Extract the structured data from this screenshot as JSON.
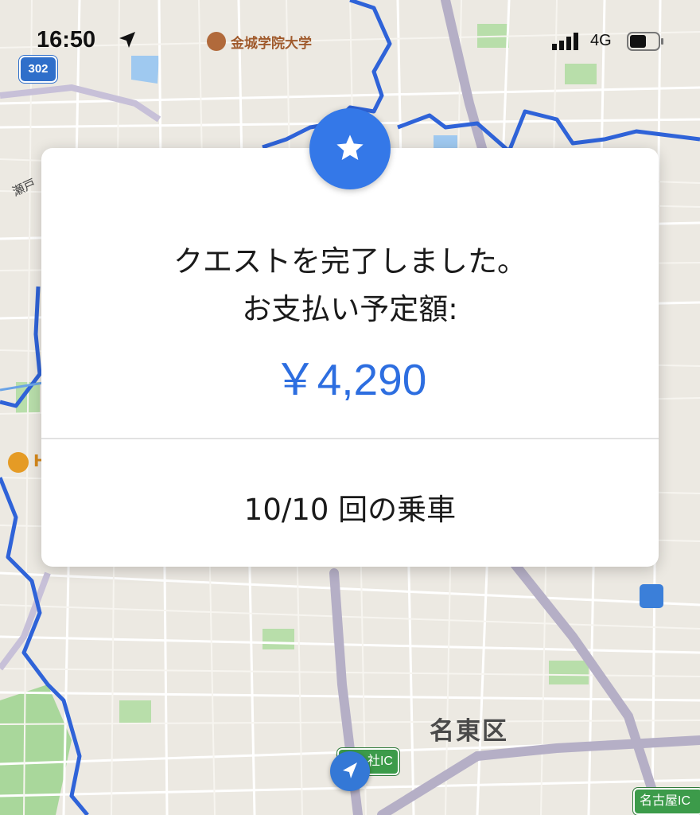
{
  "status_bar": {
    "time": "16:50",
    "network": "4G",
    "icons": [
      "location-arrow-icon",
      "signal-bars-icon",
      "battery-icon"
    ]
  },
  "map": {
    "university_label": "金城学院大学",
    "route_number": "302",
    "area_label_partial": "瀬戸",
    "district_label": "名東区",
    "interchange_1": "社IC",
    "interchange_2": "名古屋IC",
    "shop_label_partial": "H",
    "colors": {
      "road_major": "#b5afc6",
      "boundary": "#2f63d8",
      "park": "#a8d89a"
    }
  },
  "dialog": {
    "message_line1": "クエストを完了しました。",
    "message_line2": "お支払い予定額:",
    "amount": "￥4,290",
    "rides": "10/10 回の乗車",
    "icon": "star-icon",
    "colors": {
      "accent": "#3478e8",
      "amount": "#2d6ee0"
    }
  }
}
